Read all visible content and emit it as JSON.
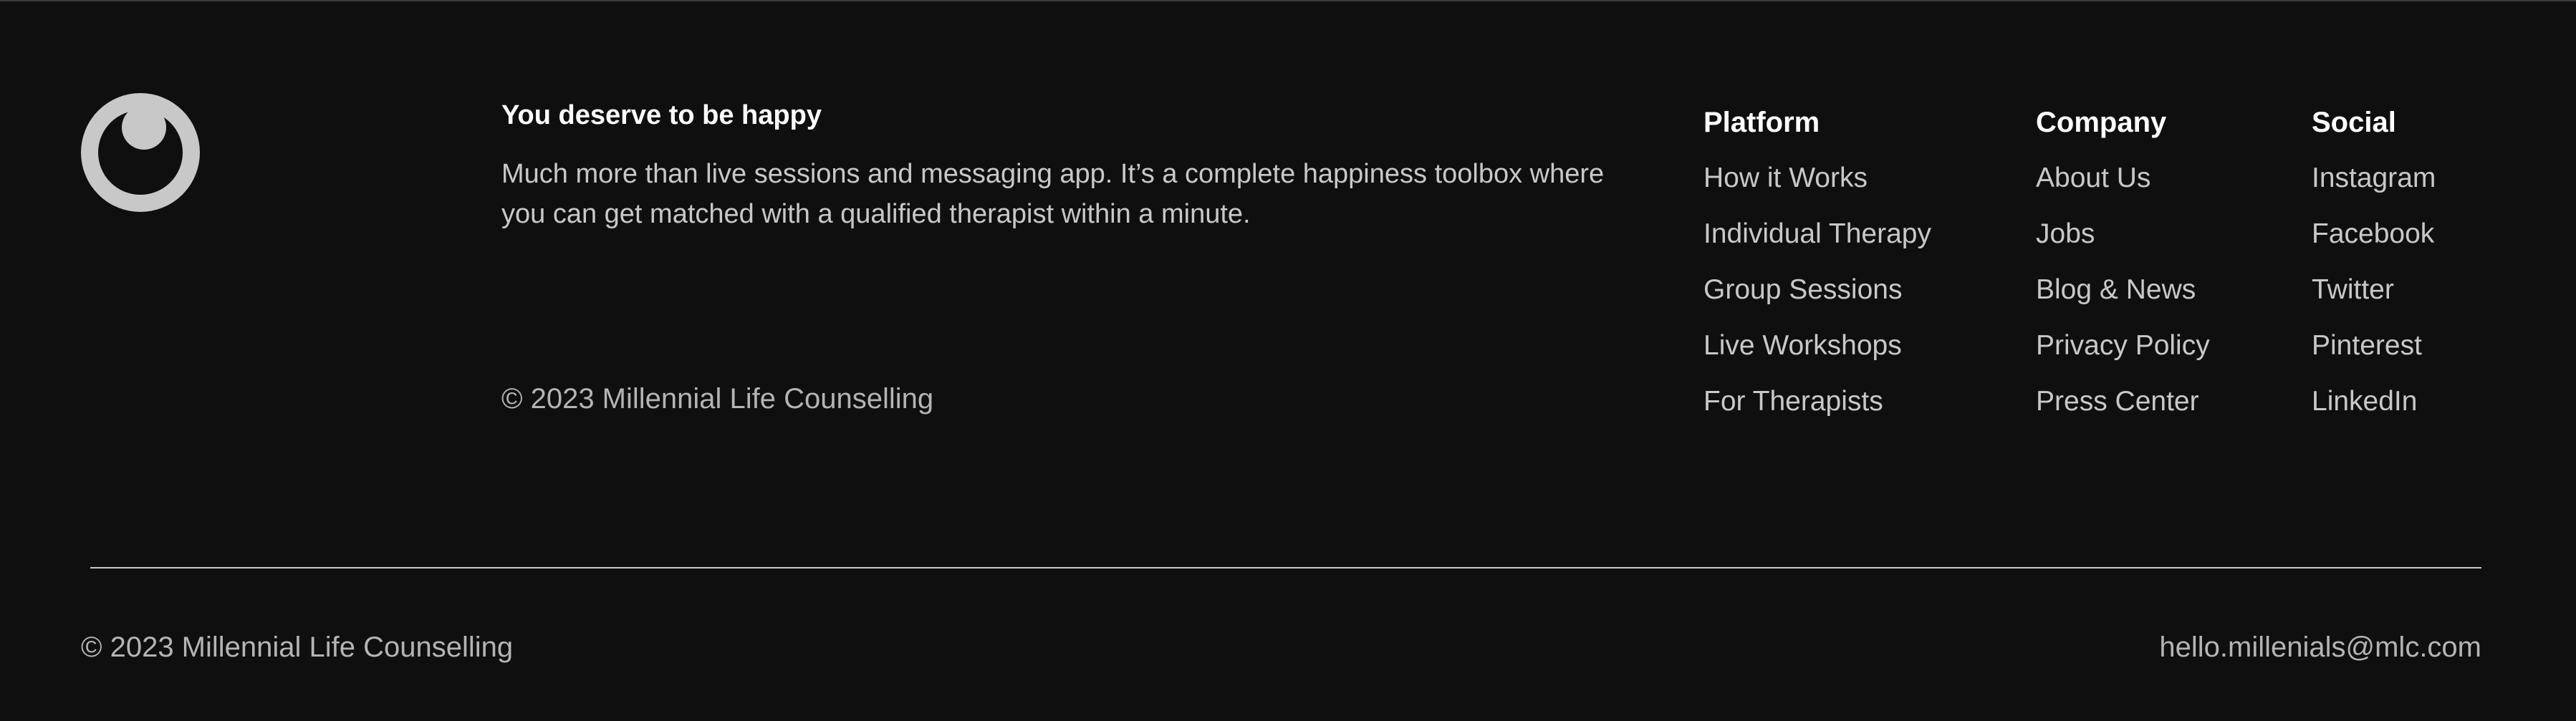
{
  "brand": {
    "logo_icon": "eye-circle-logo-icon",
    "logo_color": "#c8c8c8"
  },
  "intro": {
    "tagline": "You deserve to be happy",
    "description": "Much more than live sessions and messaging app. It’s a complete happiness toolbox where you can get matched with a qualified therapist within a minute.",
    "copyright": "© 2023 Millennial Life Counselling"
  },
  "columns": {
    "platform": {
      "heading": "Platform",
      "links": [
        "How it Works",
        "Individual Therapy",
        "Group Sessions",
        "Live Workshops",
        "For Therapists"
      ]
    },
    "company": {
      "heading": "Company",
      "links": [
        "About Us",
        "Jobs",
        "Blog & News",
        "Privacy Policy",
        "Press Center"
      ]
    },
    "social": {
      "heading": "Social",
      "links": [
        "Instagram",
        "Facebook",
        "Twitter",
        "Pinterest",
        "LinkedIn"
      ]
    }
  },
  "bottom": {
    "copyright": "© 2023 Millennial Life Counselling",
    "email": "hello.millenials@mlc.com"
  },
  "colors": {
    "background": "#0f0f0f",
    "heading": "#ffffff",
    "text": "#c8c8c8"
  }
}
